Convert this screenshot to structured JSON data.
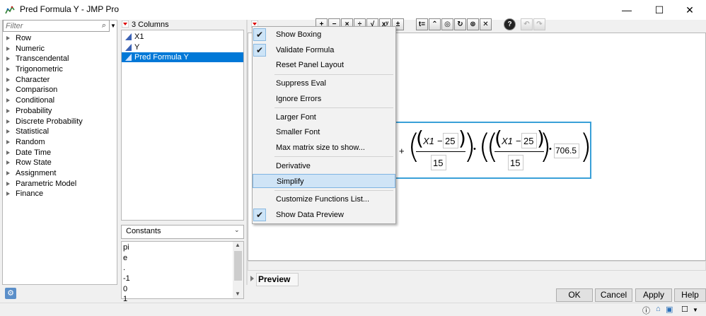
{
  "window": {
    "title": "Pred Formula Y - JMP Pro",
    "minimize_glyph": "—",
    "maximize_glyph": "☐",
    "close_glyph": "✕"
  },
  "functions": {
    "filter_placeholder": "Filter",
    "categories": [
      "Row",
      "Numeric",
      "Transcendental",
      "Trigonometric",
      "Character",
      "Comparison",
      "Conditional",
      "Probability",
      "Discrete Probability",
      "Statistical",
      "Random",
      "Date Time",
      "Row State",
      "Assignment",
      "Parametric Model",
      "Finance"
    ]
  },
  "columns": {
    "header": "3 Columns",
    "items": [
      "X1",
      "Y",
      "Pred Formula Y"
    ],
    "selected": "Pred Formula Y"
  },
  "constants": {
    "selected": "Constants",
    "items": [
      "pi",
      "e",
      ".",
      "-1",
      "0",
      "1"
    ]
  },
  "toolbar": {
    "icons": [
      "plus-icon",
      "minus-icon",
      "times-icon",
      "divide-icon",
      "root-icon",
      "power-icon",
      "plus-minus-icon",
      "assign-icon",
      "peel-icon",
      "unary-icon",
      "swap-icon",
      "local-icon",
      "delete-icon",
      "help-icon",
      "undo-icon",
      "redo-icon"
    ],
    "labels": [
      "+",
      "−",
      "×",
      "÷",
      "√",
      "xʸ",
      "±",
      "t=",
      "⌃",
      "◎",
      "↻",
      "⊛",
      "✕",
      "?",
      "↶",
      "↷"
    ]
  },
  "context_menu": {
    "items": [
      {
        "label": "Show Boxing",
        "checked": true
      },
      {
        "label": "Validate Formula",
        "checked": true
      },
      {
        "label": "Reset Panel Layout",
        "checked": false
      },
      {
        "label": "Suppress Eval",
        "checked": false
      },
      {
        "label": "Ignore Errors",
        "checked": false
      },
      {
        "label": "Larger Font",
        "checked": false
      },
      {
        "label": "Smaller Font",
        "checked": false
      },
      {
        "label": "Max matrix size to show...",
        "checked": false
      },
      {
        "label": "Derivative",
        "checked": false
      },
      {
        "label": "Simplify",
        "checked": false,
        "highlighted": true
      },
      {
        "label": "Customize Functions List...",
        "checked": false
      },
      {
        "label": "Show Data Preview",
        "checked": true
      }
    ]
  },
  "formula": {
    "plus": "+",
    "var": "X1",
    "minus": "−",
    "center": "25",
    "scale": "15",
    "dot": "•",
    "coef": "706.5"
  },
  "preview": {
    "label": "Preview"
  },
  "buttons": {
    "ok": "OK",
    "cancel": "Cancel",
    "apply": "Apply",
    "help": "Help"
  },
  "colors": {
    "accent": "#0078d7",
    "formula_border": "#3aa0d8",
    "menu_highlight": "#cfe4f6"
  }
}
